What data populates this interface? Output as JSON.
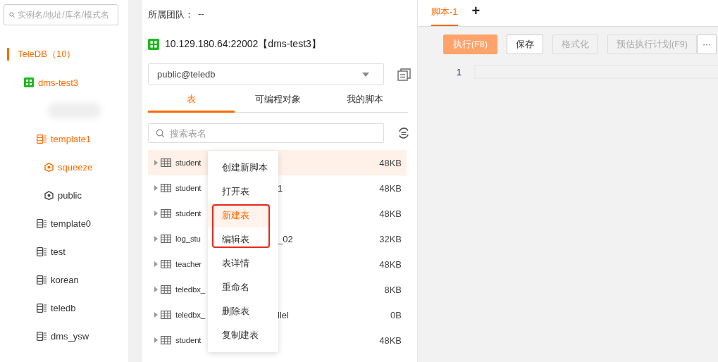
{
  "sidebar": {
    "search": {
      "placeholder": "实例名/地址/库名/模式名"
    },
    "tree": [
      {
        "label": "TeleDB（10）",
        "kind": "group",
        "selected": true,
        "children": [
          {
            "label": "dms-test3",
            "kind": "instance",
            "selected": true,
            "children": [
              {
                "kind": "redacted"
              },
              {
                "label": "template1",
                "kind": "database",
                "selected": true,
                "children": [
                  {
                    "label": "squeeze",
                    "kind": "schema",
                    "selected": true
                  },
                  {
                    "label": "public",
                    "kind": "schema",
                    "selected": false
                  }
                ]
              },
              {
                "label": "template0",
                "kind": "database",
                "selected": false
              },
              {
                "label": "test",
                "kind": "database",
                "selected": false
              },
              {
                "label": "korean",
                "kind": "database",
                "selected": false
              },
              {
                "label": "teledb",
                "kind": "database",
                "selected": false
              },
              {
                "label": "dms_ysw",
                "kind": "database",
                "selected": false
              }
            ]
          }
        ]
      }
    ]
  },
  "object_panel": {
    "team": {
      "label": "所属团队：",
      "value": "--"
    },
    "instance": "10.129.180.64:22002【dms-test3】",
    "schema_select": {
      "value": "public@teledb"
    },
    "tabs": [
      {
        "label": "表",
        "selected": true
      },
      {
        "label": "可编程对象",
        "selected": false
      },
      {
        "label": "我的脚本",
        "selected": false
      }
    ],
    "search": {
      "placeholder": "搜索表名"
    },
    "tables": [
      {
        "name": "student",
        "size": "48KB",
        "selected": true
      },
      {
        "name": "student",
        "tail": "1",
        "size": "48KB",
        "selected": false
      },
      {
        "name": "student",
        "size": "48KB",
        "selected": false
      },
      {
        "name": "log_stu",
        "tail": "_02",
        "size": "32KB",
        "selected": false
      },
      {
        "name": "teacher",
        "size": "48KB",
        "selected": false
      },
      {
        "name": "teledbx_",
        "size": "8KB",
        "selected": false
      },
      {
        "name": "teledbx_",
        "tail": "llel",
        "size": "0B",
        "selected": false
      },
      {
        "name": "student",
        "size": "48KB",
        "selected": false
      }
    ],
    "context_menu": [
      {
        "label": "创建新脚本",
        "selected": false,
        "boxed": false
      },
      {
        "label": "打开表",
        "selected": false,
        "boxed": false
      },
      {
        "label": "新建表",
        "selected": true,
        "boxed": true
      },
      {
        "label": "编辑表",
        "selected": false,
        "boxed": true
      },
      {
        "label": "表详情",
        "selected": false,
        "boxed": false
      },
      {
        "label": "重命名",
        "selected": false,
        "boxed": false
      },
      {
        "label": "删除表",
        "selected": false,
        "boxed": false
      },
      {
        "label": "复制建表",
        "selected": false,
        "boxed": false
      }
    ]
  },
  "editor": {
    "tabs": [
      {
        "label": "脚本-1",
        "selected": true
      }
    ],
    "add_tab": "+",
    "toolbar": [
      {
        "label": "执行(F8)",
        "kind": "primary",
        "disabled": false
      },
      {
        "label": "保存",
        "kind": "default",
        "disabled": false
      },
      {
        "label": "格式化",
        "kind": "default",
        "disabled": true
      },
      {
        "label": "预估执行计划(F9)",
        "kind": "default",
        "disabled": true
      },
      {
        "label": "···",
        "kind": "more",
        "disabled": false
      }
    ],
    "line_numbers": [
      "1"
    ]
  }
}
